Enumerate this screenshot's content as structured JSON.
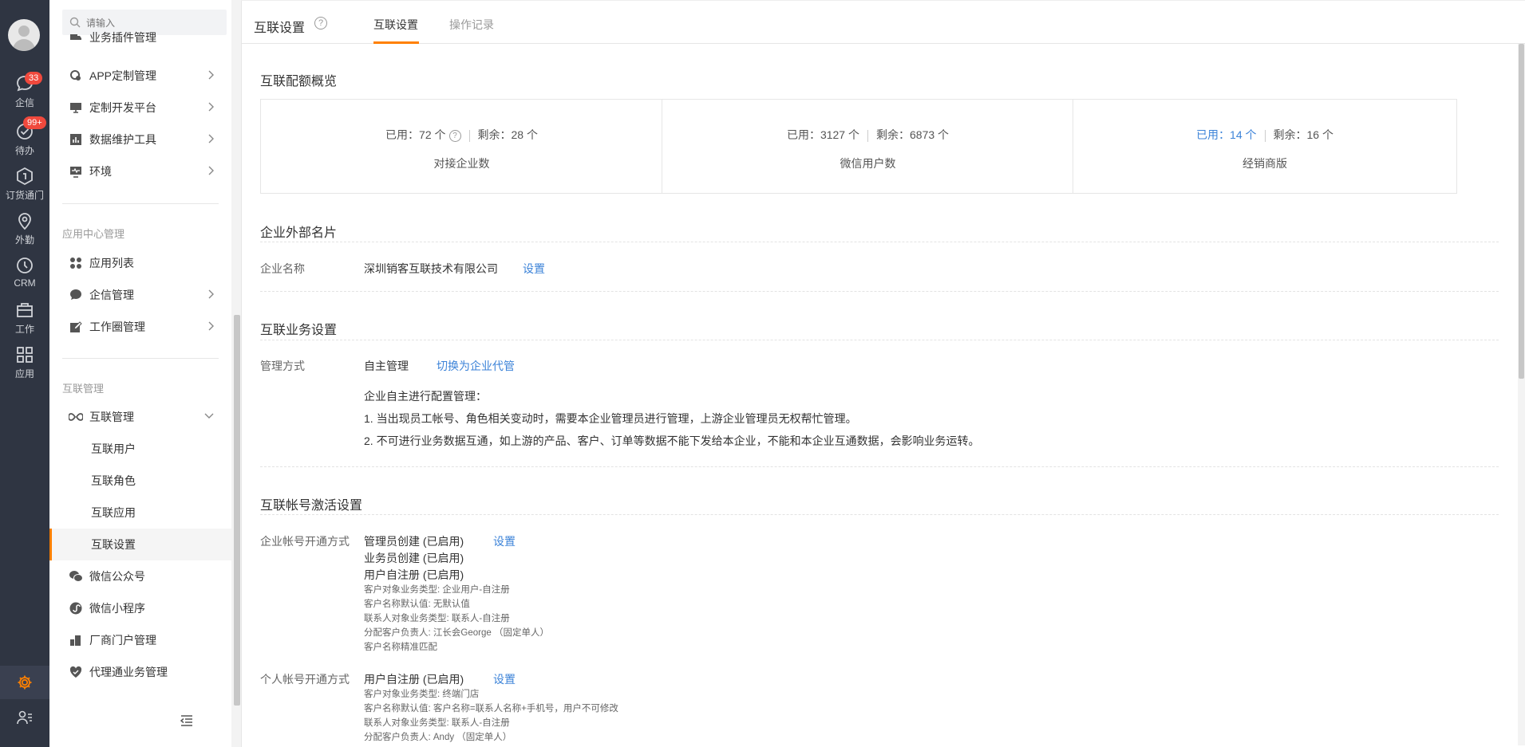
{
  "rail": {
    "items": [
      {
        "label": "企信",
        "icon": "chat-icon",
        "badge": "33"
      },
      {
        "label": "待办",
        "icon": "check-circle-icon",
        "badge": "99+"
      },
      {
        "label": "订货通门",
        "icon": "box-icon",
        "badge": ""
      },
      {
        "label": "外勤",
        "icon": "location-pin-icon",
        "badge": ""
      },
      {
        "label": "CRM",
        "icon": "clock-icon",
        "badge": ""
      },
      {
        "label": "工作",
        "icon": "briefcase-icon",
        "badge": ""
      },
      {
        "label": "应用",
        "icon": "grid-icon",
        "badge": ""
      }
    ],
    "accent": "#ff8000"
  },
  "sidenav": {
    "search_placeholder": "请输入",
    "items_top": [
      {
        "label": "业务插件管理"
      },
      {
        "label": "APP定制管理"
      },
      {
        "label": "定制开发平台"
      },
      {
        "label": "数据维护工具"
      },
      {
        "label": "环境"
      }
    ],
    "group_app_center": "应用中心管理",
    "items_app": [
      {
        "label": "应用列表"
      },
      {
        "label": "企信管理"
      },
      {
        "label": "工作圈管理"
      }
    ],
    "group_interconnect": "互联管理",
    "interconnect_parent": "互联管理",
    "interconnect_children": [
      "互联用户",
      "互联角色",
      "互联应用",
      "互联设置"
    ],
    "items_bottom": [
      {
        "label": "微信公众号"
      },
      {
        "label": "微信小程序"
      },
      {
        "label": "厂商门户管理"
      },
      {
        "label": "代理通业务管理"
      }
    ]
  },
  "header": {
    "title": "互联设置",
    "help": "?",
    "tabs": [
      "互联设置",
      "操作记录"
    ]
  },
  "quota": {
    "title": "互联配额概览",
    "cells": [
      {
        "used": "已用：72 个",
        "left": "剩余：28 个",
        "caption": "对接企业数",
        "help": "?"
      },
      {
        "used": "已用：3127 个",
        "left": "剩余：6873 个",
        "caption": "微信用户数"
      },
      {
        "used": "已用：14 个",
        "left": "剩余：16 个",
        "caption": "经销商版"
      }
    ]
  },
  "card": {
    "title": "企业外部名片",
    "label": "企业名称",
    "value": "深圳销客互联技术有限公司",
    "action": "设置"
  },
  "business": {
    "title": "互联业务设置",
    "label": "管理方式",
    "value": "自主管理",
    "action": "切换为企业代管",
    "desc_title": "企业自主进行配置管理：",
    "desc_1": "1. 当出现员工帐号、角色相关变动时，需要本企业管理员进行管理，上游企业管理员无权帮忙管理。",
    "desc_2": "2. 不可进行业务数据互通，如上游的产品、客户、订单等数据不能下发给本企业，不能和本企业互通数据，会影响业务运转。"
  },
  "activation": {
    "title": "互联帐号激活设置",
    "enterprise_label": "企业帐号开通方式",
    "enterprise_lines": [
      "管理员创建 (已启用)",
      "业务员创建 (已启用)",
      "用户自注册 (已启用)"
    ],
    "enterprise_details": [
      "客户对象业务类型:  企业用户-自注册",
      "客户名称默认值:  无默认值",
      "联系人对象业务类型:  联系人-自注册",
      "分配客户负责人:  江长会George （固定单人）",
      "客户名称精准匹配"
    ],
    "enterprise_action": "设置",
    "personal_label": "个人帐号开通方式",
    "personal_line": "用户自注册 (已启用)",
    "personal_details": [
      "客户对象业务类型:  终端门店",
      "客户名称默认值:  客户名称=联系人名称+手机号，用户不可修改",
      "联系人对象业务类型:  联系人-自注册",
      "分配客户负责人:  Andy （固定单人）"
    ],
    "personal_action": "设置"
  }
}
